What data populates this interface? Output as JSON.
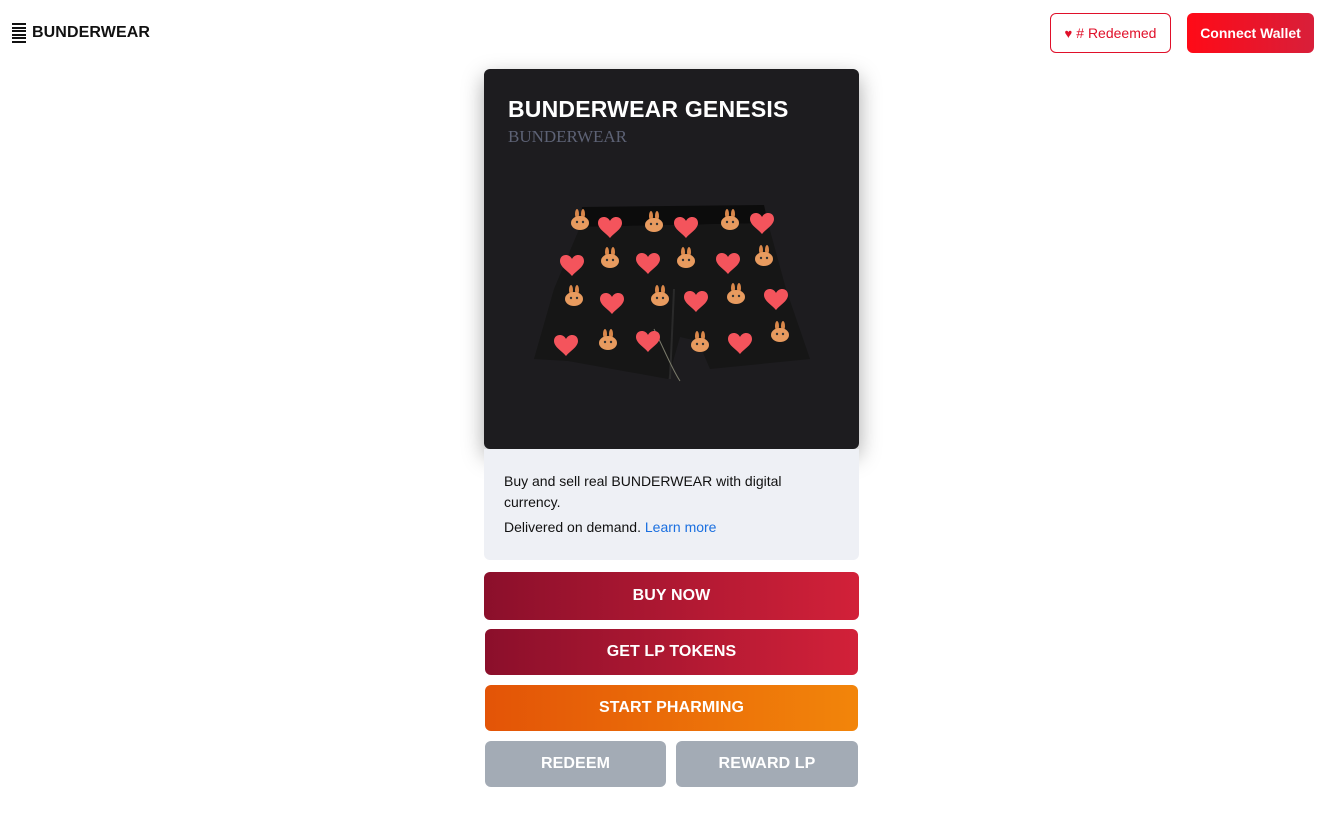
{
  "header": {
    "logo_text": "BUNDERWEAR",
    "redeemed_icon": "♥",
    "redeemed_label": "# Redeemed",
    "wallet_label": "Connect Wallet"
  },
  "card": {
    "title": "BUNDERWEAR GENESIS",
    "subtitle": "BUNDERWEAR",
    "image_icon": "boxer-shorts-image"
  },
  "description": {
    "line1": "Buy and sell real BUNDERWEAR with digital currency.",
    "line2": "Delivered on demand.",
    "link": "Learn more"
  },
  "actions": {
    "buy": "BUY NOW",
    "lp": "GET LP TOKENS",
    "pharm": "START PHARMING",
    "redeem": "REDEEM",
    "reward": "REWARD LP"
  },
  "colors": {
    "brand_red": "#e0102a",
    "buy_gradient": [
      "#8b0f2b",
      "#d22139"
    ],
    "pharm_gradient": [
      "#e35407",
      "#f2850a"
    ],
    "disabled": "#a3abb5",
    "card_bg": "#1d1c1f",
    "desc_bg": "#eef0f5"
  }
}
